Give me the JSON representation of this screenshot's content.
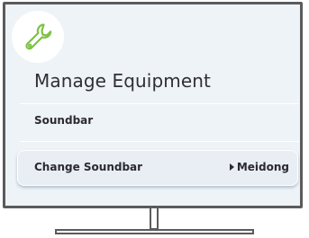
{
  "screen": {
    "icon": "wrench-icon",
    "icon_color": "#7dc243",
    "title": "Manage Equipment",
    "section_label": "Soundbar",
    "menu_item": {
      "label": "Change Soundbar",
      "value": "Meidong",
      "arrow_icon": "arrow-right-icon"
    }
  },
  "colors": {
    "screen_background": "#eef3f8",
    "frame": "#5b5b5b",
    "text": "#2a2a2f"
  }
}
